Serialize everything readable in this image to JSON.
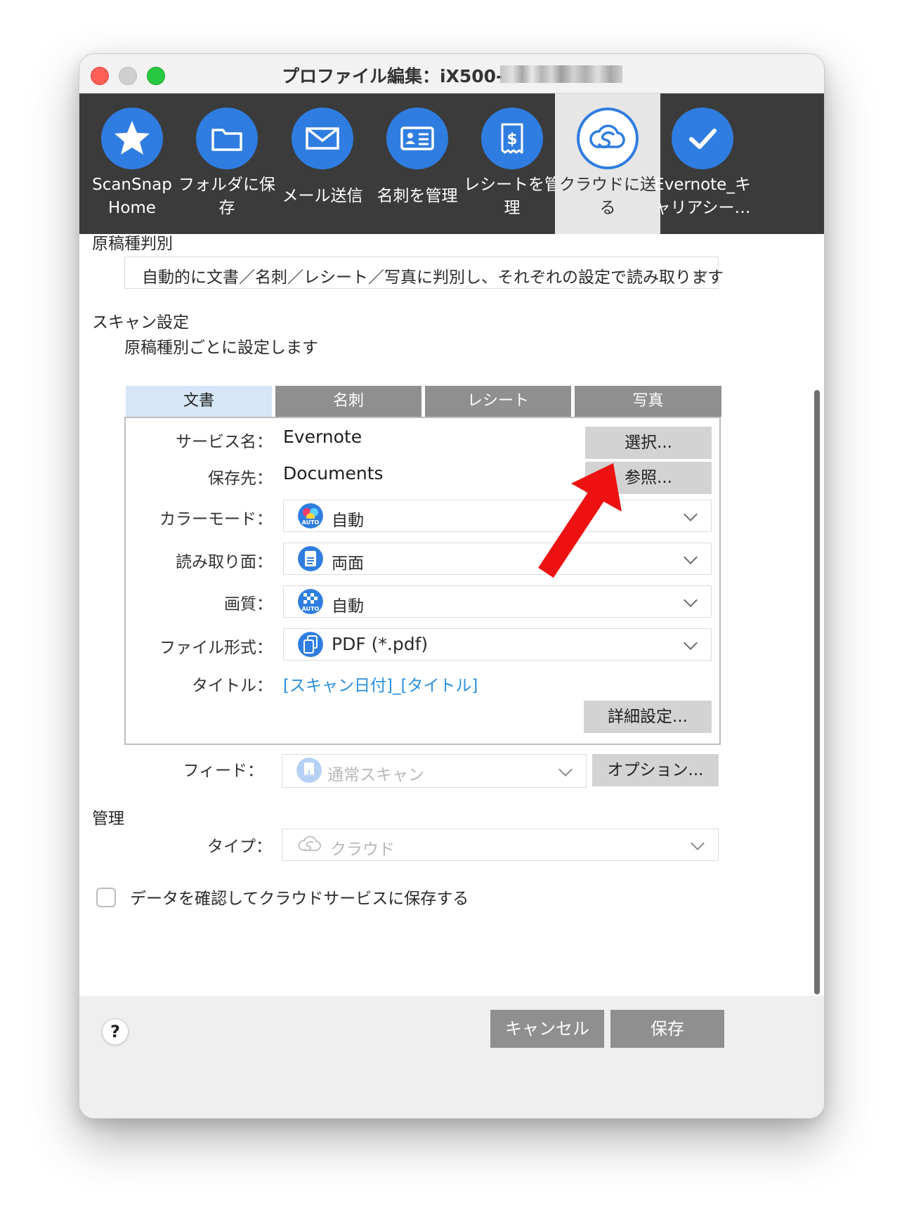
{
  "window": {
    "title": "プロファイル編集：iX500-"
  },
  "toolbar": {
    "items": [
      {
        "label": "ScanSnap\nHome",
        "icon": "star-icon"
      },
      {
        "label": "フォルダに保\n存",
        "icon": "folder-icon"
      },
      {
        "label": "メール送信",
        "icon": "mail-icon"
      },
      {
        "label": "名刺を管理",
        "icon": "business-card-icon"
      },
      {
        "label": "レシートを管\n理",
        "icon": "receipt-icon"
      },
      {
        "label": "クラウドに送\nる",
        "icon": "cloud-s-icon",
        "active": true
      },
      {
        "label": "Evernote_キ\nャリアシー…",
        "icon": "checkmark-icon"
      }
    ]
  },
  "doc_type": {
    "heading": "原稿種判別",
    "value": "自動的に文書／名刺／レシート／写真に判別し、それぞれの設定で読み取ります"
  },
  "scan_settings": {
    "heading": "スキャン設定",
    "subheading": "原稿種別ごとに設定します",
    "tabs": [
      "文書",
      "名刺",
      "レシート",
      "写真"
    ],
    "active_tab": "文書",
    "service_name": {
      "label": "サービス名：",
      "value": "Evernote",
      "button": "選択..."
    },
    "save_to": {
      "label": "保存先：",
      "value": "Documents",
      "button": "参照..."
    },
    "color_mode": {
      "label": "カラーモード：",
      "value": "自動"
    },
    "scan_side": {
      "label": "読み取り面：",
      "value": "両面"
    },
    "quality": {
      "label": "画質：",
      "value": "自動"
    },
    "file_format": {
      "label": "ファイル形式：",
      "value": "PDF (*.pdf)"
    },
    "title": {
      "label": "タイトル：",
      "value": "[スキャン日付]_[タイトル]"
    },
    "detail_button": "詳細設定...",
    "feed": {
      "label": "フィード：",
      "value": "通常スキャン",
      "button": "オプション..."
    }
  },
  "management": {
    "heading": "管理",
    "type_label": "タイプ：",
    "type_value": "クラウド",
    "confirm_checkbox": "データを確認してクラウドサービスに保存する",
    "confirm_checked": false
  },
  "footer": {
    "help": "?",
    "cancel": "キャンセル",
    "save": "保存"
  },
  "colors": {
    "accent": "#2f7de0",
    "toolbar_bg": "#3b3b3b",
    "link": "#2b8fe0",
    "annotation_arrow": "#ee1111"
  }
}
